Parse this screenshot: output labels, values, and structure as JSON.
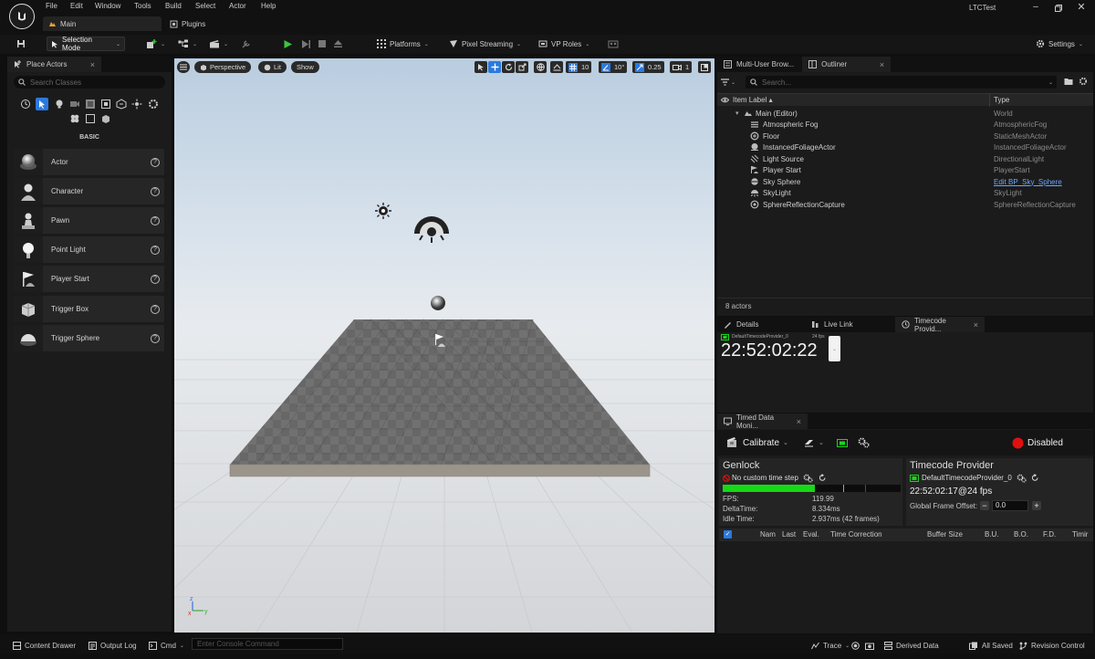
{
  "window": {
    "project": "LTCTest",
    "tabs": {
      "main": "Main",
      "plugins": "Plugins"
    }
  },
  "menu": [
    "File",
    "Edit",
    "Window",
    "Tools",
    "Build",
    "Select",
    "Actor",
    "Help"
  ],
  "toolbar": {
    "selection_mode": "Selection Mode",
    "platforms": "Platforms",
    "pixel_streaming": "Pixel Streaming",
    "vp_roles": "VP Roles",
    "settings": "Settings"
  },
  "place_actors": {
    "tab": "Place Actors",
    "search_placeholder": "Search Classes",
    "category": "BASIC",
    "items": [
      {
        "label": "Actor"
      },
      {
        "label": "Character"
      },
      {
        "label": "Pawn"
      },
      {
        "label": "Point Light"
      },
      {
        "label": "Player Start"
      },
      {
        "label": "Trigger Box"
      },
      {
        "label": "Trigger Sphere"
      }
    ]
  },
  "viewport": {
    "perspective": "Perspective",
    "lit": "Lit",
    "show": "Show",
    "grid_snap": "10",
    "rotation_snap": "10°",
    "scale_snap": "0.25",
    "camera_speed": "1"
  },
  "outliner": {
    "tab_multiuser": "Multi-User Brow...",
    "tab_outliner": "Outliner",
    "search_placeholder": "Search...",
    "col_label": "Item Label",
    "col_type": "Type",
    "root_label": "Main (Editor)",
    "root_type": "World",
    "rows": [
      {
        "label": "Atmospheric Fog",
        "type": "AtmosphericFog"
      },
      {
        "label": "Floor",
        "type": "StaticMeshActor"
      },
      {
        "label": "InstancedFoliageActor",
        "type": "InstancedFoliageActor"
      },
      {
        "label": "Light Source",
        "type": "DirectionalLight"
      },
      {
        "label": "Player Start",
        "type": "PlayerStart"
      },
      {
        "label": "Sky Sphere",
        "type": "Edit BP_Sky_Sphere"
      },
      {
        "label": "SkyLight",
        "type": "SkyLight"
      },
      {
        "label": "SphereReflectionCapture",
        "type": "SphereReflectionCapture"
      }
    ],
    "count": "8 actors"
  },
  "details": {
    "tab_details": "Details",
    "tab_livelink": "Live Link",
    "tab_timecode": "Timecode Provid...",
    "provider_name": "DefaultTimecodeProvider_0",
    "fps": "24 fps",
    "timecode": "22:52:02:22"
  },
  "tdm": {
    "tab": "Timed Data Moni...",
    "calibrate": "Calibrate",
    "disabled": "Disabled",
    "genlock": "Genlock",
    "no_custom": "No custom time step",
    "fps_label": "FPS:",
    "fps_value": "119.99",
    "delta_label": "DeltaTime:",
    "delta_value": "8.334ms",
    "idle_label": "Idle Time:",
    "idle_value": "2.937ms (42 frames)",
    "tc_title": "Timecode Provider",
    "tc_provider": "DefaultTimecodeProvider_0",
    "tc_value": "22:52:02:17@24 fps",
    "gfo_label": "Global Frame Offset:",
    "gfo_value": "0.0",
    "columns": [
      "Nam",
      "Last",
      "Eval.",
      "Time Correction",
      "Buffer Size",
      "B.U.",
      "B.O.",
      "F.D.",
      "Timir"
    ],
    "colors": {
      "green": "#16d916",
      "red": "#e01010",
      "accent_blue": "#2a7ade"
    }
  },
  "statusbar": {
    "content_drawer": "Content Drawer",
    "output_log": "Output Log",
    "cmd": "Cmd",
    "console_placeholder": "Enter Console Command",
    "trace": "Trace",
    "derived_data": "Derived Data",
    "all_saved": "All Saved",
    "revision_control": "Revision Control"
  }
}
